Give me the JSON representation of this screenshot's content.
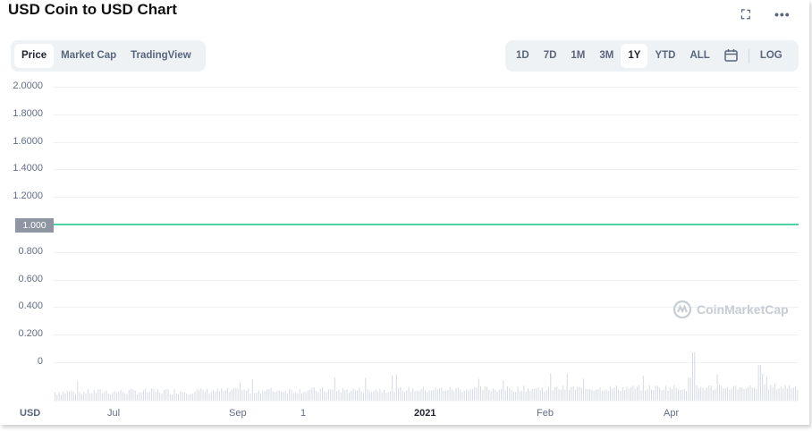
{
  "title": "USD Coin to USD Chart",
  "tabs": [
    {
      "label": "Price",
      "active": true
    },
    {
      "label": "Market Cap"
    },
    {
      "label": "TradingView"
    }
  ],
  "ranges": [
    {
      "label": "1D"
    },
    {
      "label": "7D"
    },
    {
      "label": "1M"
    },
    {
      "label": "3M"
    },
    {
      "label": "1Y",
      "active": true
    },
    {
      "label": "YTD"
    },
    {
      "label": "ALL"
    }
  ],
  "log_label": "LOG",
  "y_axis": [
    "2.0000",
    "1.8000",
    "1.6000",
    "1.4000",
    "1.2000",
    "1.000",
    "0.800",
    "0.600",
    "0.400",
    "0.200",
    "0"
  ],
  "current_price_label": "1.000",
  "x_axis": {
    "currency": "USD",
    "ticks": [
      "Jul",
      "Sep",
      "1",
      "2021",
      "Feb",
      "Apr"
    ]
  },
  "watermark": "CoinMarketCap",
  "colors": {
    "line": "#16c784",
    "volume": "#d5d9e3"
  }
}
